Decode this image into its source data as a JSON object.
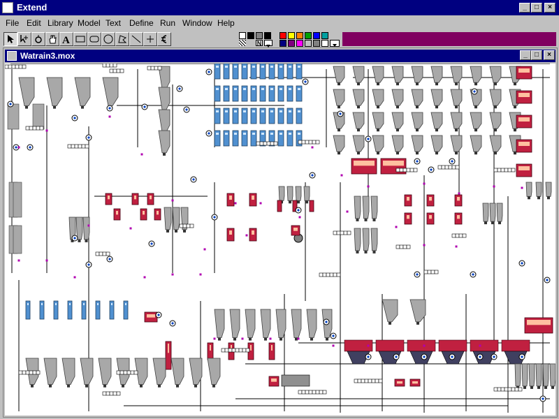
{
  "app": {
    "title": "Extend"
  },
  "menu": [
    "File",
    "Edit",
    "Library",
    "Model",
    "Text",
    "Define",
    "Run",
    "Window",
    "Help"
  ],
  "toolbar": {
    "pattern_label": "N",
    "colors": {
      "accent": "#800060",
      "palette_row1": [
        "#ff0000",
        "#ffff00",
        "#ff8000",
        "#00a000",
        "#0000ff",
        "#00a0a0"
      ],
      "palette_row2": [
        "#000080",
        "#800080",
        "#ff00ff",
        "#c0c0c0",
        "#808080",
        "#000000"
      ]
    }
  },
  "document": {
    "title": "Watrain3.mox"
  },
  "diagram": {
    "colors": {
      "tank": "#a8a8a8",
      "reactor": "#c02040",
      "column": "#5090d0",
      "pipe": "#000000",
      "block": "#d8d8d8",
      "connector": "#b000b0"
    }
  }
}
